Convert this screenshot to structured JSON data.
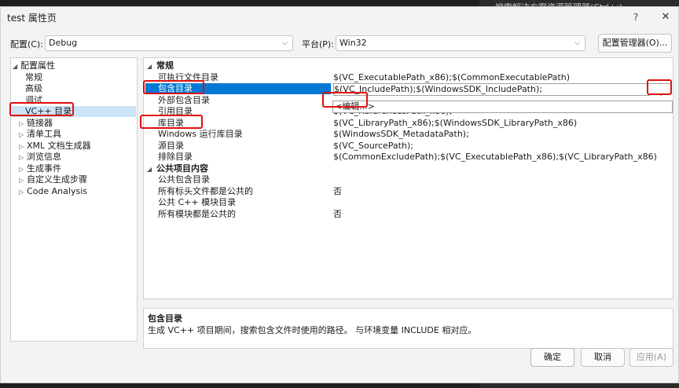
{
  "background": {
    "text": "搜索解决方案资源管理器(Ctrl+;)"
  },
  "window": {
    "title": "test 属性页",
    "help": "?",
    "close": "✕"
  },
  "config": {
    "label": "配置(C):",
    "value": "Debug"
  },
  "platform": {
    "label": "平台(P):",
    "value": "Win32"
  },
  "config_manager": "配置管理器(O)...",
  "tree": {
    "root": "配置属性",
    "items": [
      {
        "label": "常规",
        "expandable": false
      },
      {
        "label": "高级",
        "expandable": false
      },
      {
        "label": "调试",
        "expandable": false
      },
      {
        "label": "VC++ 目录",
        "expandable": false,
        "selected": true
      },
      {
        "label": "链接器",
        "expandable": true
      },
      {
        "label": "清单工具",
        "expandable": true
      },
      {
        "label": "XML 文档生成器",
        "expandable": true
      },
      {
        "label": "浏览信息",
        "expandable": true
      },
      {
        "label": "生成事件",
        "expandable": true
      },
      {
        "label": "自定义生成步骤",
        "expandable": true
      },
      {
        "label": "Code Analysis",
        "expandable": true
      }
    ]
  },
  "grid": {
    "categories": [
      {
        "name": "常规",
        "rows": [
          {
            "name": "可执行文件目录",
            "value": "$(VC_ExecutablePath_x86);$(CommonExecutablePath)"
          },
          {
            "name": "包含目录",
            "value": "$(VC_IncludePath);$(WindowsSDK_IncludePath);",
            "selected": true
          },
          {
            "name": "外部包含目录",
            "value": ""
          },
          {
            "name": "引用目录",
            "value": "$(VC_ReferencesPath_x86);"
          },
          {
            "name": "库目录",
            "value": "$(VC_LibraryPath_x86);$(WindowsSDK_LibraryPath_x86)"
          },
          {
            "name": "Windows 运行库目录",
            "value": "$(WindowsSDK_MetadataPath);"
          },
          {
            "name": "源目录",
            "value": "$(VC_SourcePath);"
          },
          {
            "name": "排除目录",
            "value": "$(CommonExcludePath);$(VC_ExecutablePath_x86);$(VC_LibraryPath_x86)"
          }
        ]
      },
      {
        "name": "公共项目内容",
        "rows": [
          {
            "name": "公共包含目录",
            "value": ""
          },
          {
            "name": "所有标头文件都是公共的",
            "value": "否"
          },
          {
            "name": "公共 C++ 模块目录",
            "value": ""
          },
          {
            "name": "所有模块都是公共的",
            "value": "否"
          }
        ]
      }
    ],
    "dropdown_option": "<编辑...>"
  },
  "description": {
    "title": "包含目录",
    "text": "生成 VC++ 项目期间，搜索包含文件时使用的路径。 与环境变量 INCLUDE 相对应。"
  },
  "buttons": {
    "ok": "确定",
    "cancel": "取消",
    "apply": "应用(A)"
  },
  "colors": {
    "selection": "#0078d4",
    "highlight": "#e01010",
    "tree_selection": "#cce4f7"
  }
}
